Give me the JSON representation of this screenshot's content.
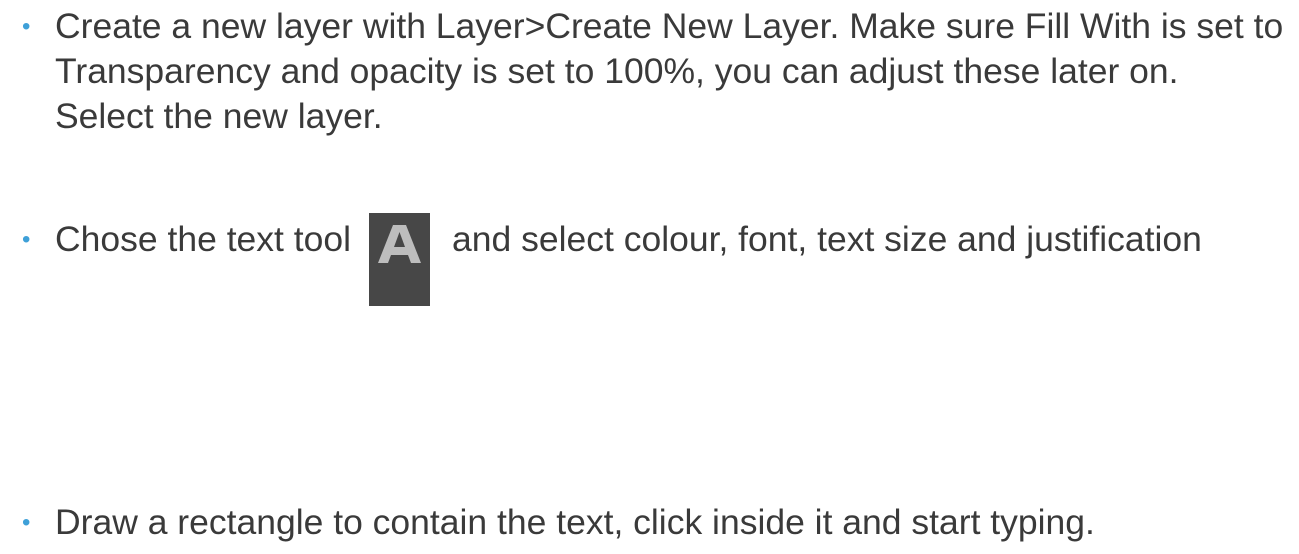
{
  "bullets": [
    {
      "text": "Create a new layer with Layer>Create New Layer. Make sure Fill With is set to Transparency and opacity is set to 100%, you can adjust these later on. Select the new layer."
    },
    {
      "text_before_icon": "Chose the text tool",
      "icon": "text-tool-icon",
      "text_after_icon": "and select colour, font, text size and justification"
    },
    {
      "text": "Draw a rectangle to contain the text, click inside it and start typing."
    }
  ],
  "colors": {
    "bullet": "#3ea0d8",
    "text": "#3a3a3a",
    "icon_background": "#474747",
    "icon_glyph": "#bdbdbd"
  }
}
